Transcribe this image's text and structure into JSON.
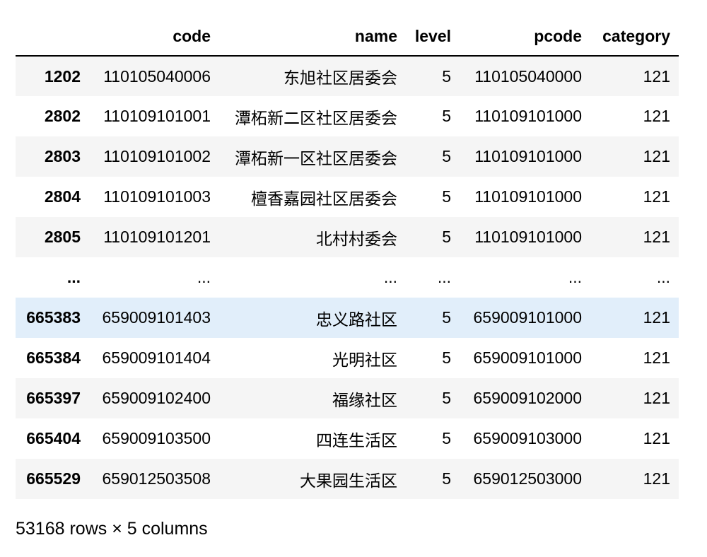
{
  "table": {
    "columns": [
      "",
      "code",
      "name",
      "level",
      "pcode",
      "category"
    ],
    "rows": [
      {
        "index": "1202",
        "code": "110105040006",
        "name": "东旭社区居委会",
        "level": "5",
        "pcode": "110105040000",
        "category": "121"
      },
      {
        "index": "2802",
        "code": "110109101001",
        "name": "潭柘新二区社区居委会",
        "level": "5",
        "pcode": "110109101000",
        "category": "121"
      },
      {
        "index": "2803",
        "code": "110109101002",
        "name": "潭柘新一区社区居委会",
        "level": "5",
        "pcode": "110109101000",
        "category": "121"
      },
      {
        "index": "2804",
        "code": "110109101003",
        "name": "檀香嘉园社区居委会",
        "level": "5",
        "pcode": "110109101000",
        "category": "121"
      },
      {
        "index": "2805",
        "code": "110109101201",
        "name": "北村村委会",
        "level": "5",
        "pcode": "110109101000",
        "category": "121"
      },
      {
        "index": "...",
        "code": "...",
        "name": "...",
        "level": "...",
        "pcode": "...",
        "category": "..."
      },
      {
        "index": "665383",
        "code": "659009101403",
        "name": "忠义路社区",
        "level": "5",
        "pcode": "659009101000",
        "category": "121"
      },
      {
        "index": "665384",
        "code": "659009101404",
        "name": "光明社区",
        "level": "5",
        "pcode": "659009101000",
        "category": "121"
      },
      {
        "index": "665397",
        "code": "659009102400",
        "name": "福缘社区",
        "level": "5",
        "pcode": "659009102000",
        "category": "121"
      },
      {
        "index": "665404",
        "code": "659009103500",
        "name": "四连生活区",
        "level": "5",
        "pcode": "659009103000",
        "category": "121"
      },
      {
        "index": "665529",
        "code": "659012503508",
        "name": "大果园生活区",
        "level": "5",
        "pcode": "659012503000",
        "category": "121"
      }
    ],
    "highlighted_row": 6,
    "colors": {
      "stripe": "#f5f5f5",
      "highlight": "#e1eefa",
      "header_rule": "#000000"
    }
  },
  "shape_info": "53168 rows × 5 columns"
}
